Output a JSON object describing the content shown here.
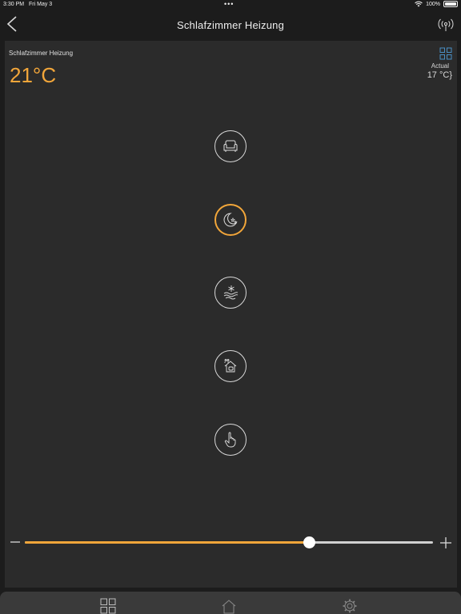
{
  "status_bar": {
    "time": "3:30 PM",
    "date": "Fri May 3",
    "dots": "•••",
    "battery": "100%"
  },
  "nav": {
    "title": "Schlafzimmer Heizung",
    "back_icon": "chevron-left-icon",
    "right_icon": "broadcast-icon"
  },
  "panel": {
    "room_label": "Schlafzimmer Heizung",
    "setpoint": "21°C",
    "actual_label": "Actual",
    "actual_value": "17 °C}",
    "grid_icon": "grid-icon"
  },
  "modes": [
    {
      "name": "comfort",
      "icon": "armchair-icon",
      "active": false
    },
    {
      "name": "night",
      "icon": "moon-stars-icon",
      "active": true
    },
    {
      "name": "frost",
      "icon": "snowflake-wind-icon",
      "active": false
    },
    {
      "name": "away",
      "icon": "house-away-icon",
      "active": false
    },
    {
      "name": "manual",
      "icon": "hand-pointer-icon",
      "active": false
    }
  ],
  "slider": {
    "value_fraction": 0.697,
    "fill_color": "#f2a63a",
    "track_color": "#d0d0d0"
  },
  "tab_bar": {
    "tabs": [
      "grid-icon",
      "home-icon",
      "gear-icon"
    ]
  },
  "colors": {
    "accent": "#f2a63a",
    "panel": "#2b2b2b",
    "background": "#1c1c1c",
    "grid_icon": "#4a8fc4"
  }
}
